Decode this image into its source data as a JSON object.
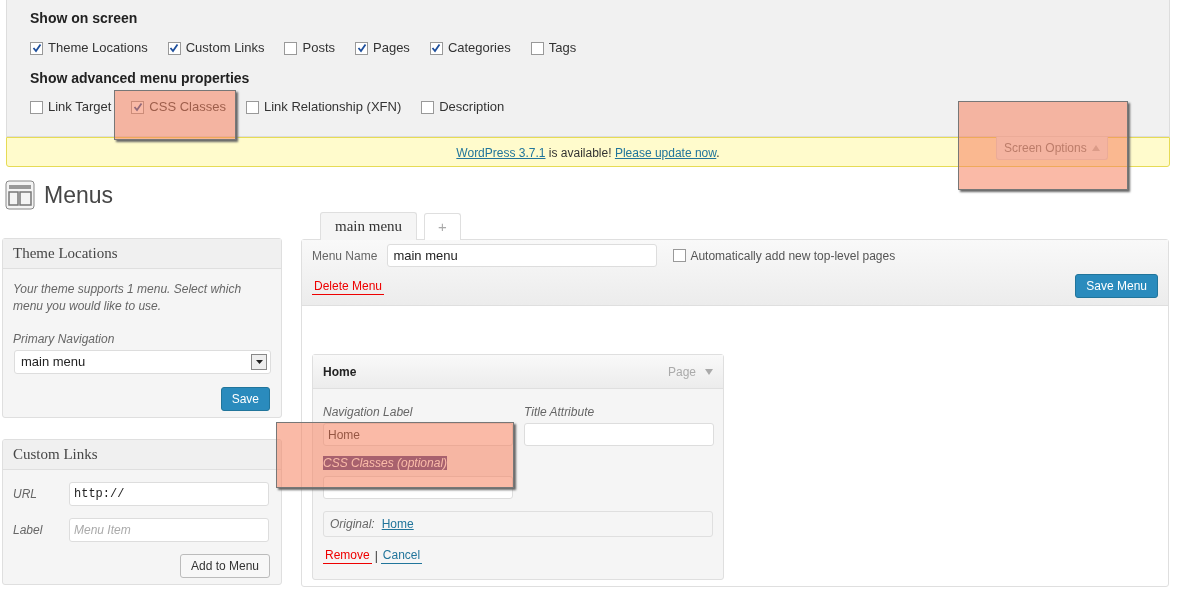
{
  "screen_options": {
    "heading": "Show on screen",
    "boxes": [
      {
        "label": "Theme Locations",
        "checked": true
      },
      {
        "label": "Custom Links",
        "checked": true
      },
      {
        "label": "Posts",
        "checked": false
      },
      {
        "label": "Pages",
        "checked": true
      },
      {
        "label": "Categories",
        "checked": true
      },
      {
        "label": "Tags",
        "checked": false
      }
    ],
    "advanced_heading": "Show advanced menu properties",
    "advanced": [
      {
        "label": "Link Target",
        "checked": false
      },
      {
        "label": "CSS Classes",
        "checked": true
      },
      {
        "label": "Link Relationship (XFN)",
        "checked": false
      },
      {
        "label": "Description",
        "checked": false
      }
    ]
  },
  "notice": {
    "version_link": "WordPress 3.7.1",
    "message": " is available! ",
    "update_link": "Please update now",
    "end": "."
  },
  "screen_options_tab": {
    "label": "Screen Options",
    "expanded": true
  },
  "page_title": "Menus",
  "theme_locations": {
    "title": "Theme Locations",
    "description": "Your theme supports 1 menu. Select which menu you would like to use.",
    "field_label": "Primary Navigation",
    "select_value": "main menu",
    "button": "Save"
  },
  "custom_links": {
    "title": "Custom Links",
    "url_label": "URL",
    "url_value": "http://",
    "label_label": "Label",
    "label_placeholder": "Menu Item",
    "button": "Add to Menu"
  },
  "menu_tabs": [
    {
      "label": "main menu",
      "selected": true
    },
    {
      "label": "+",
      "selected": false
    }
  ],
  "menu_editor": {
    "name_label": "Menu Name",
    "name_value": "main menu",
    "auto_add": {
      "label": "Automatically add new top-level pages",
      "checked": false
    },
    "delete_link": "Delete Menu",
    "save_button": "Save Menu"
  },
  "menu_item": {
    "title": "Home",
    "type": "Page",
    "expanded": true,
    "nav_label_label": "Navigation Label",
    "nav_label_value": "Home",
    "title_attr_label": "Title Attribute",
    "css_label": "CSS Classes (optional)",
    "original_label": "Original:",
    "original_link": "Home",
    "remove_link": "Remove",
    "separator": "|",
    "cancel_link": "Cancel"
  }
}
